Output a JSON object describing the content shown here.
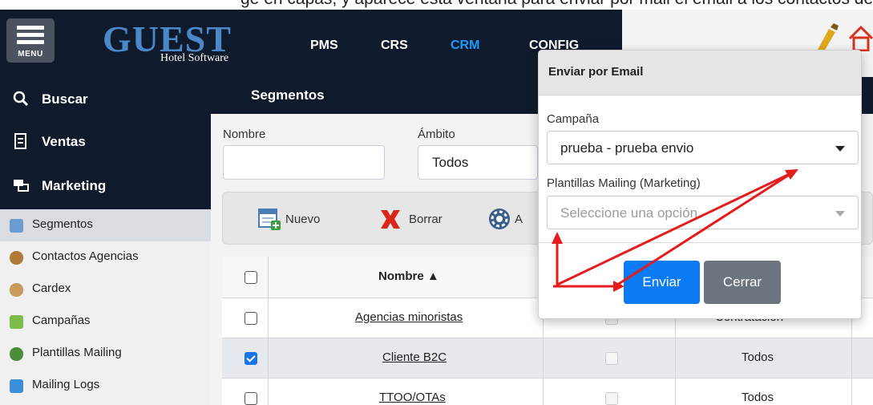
{
  "caption": "ge en capas, y aparece esta ventana para enviar por mail el email a los contactos del segmento que",
  "header": {
    "menu_label": "MENU",
    "logo": "GUEST",
    "logo_sub": "Hotel Software",
    "nav": [
      "PMS",
      "CRS",
      "CRM",
      "CONFIG"
    ],
    "active_nav": "CRM"
  },
  "sidebar": {
    "main": [
      {
        "label": "Buscar",
        "icon": "search-icon"
      },
      {
        "label": "Ventas",
        "icon": "sales-icon"
      },
      {
        "label": "Marketing",
        "icon": "marketing-icon"
      }
    ],
    "sub": [
      {
        "label": "Segmentos",
        "icon": "segments-icon",
        "active": true
      },
      {
        "label": "Contactos Agencias",
        "icon": "agency-contacts-icon"
      },
      {
        "label": "Cardex",
        "icon": "cardex-icon"
      },
      {
        "label": "Campañas",
        "icon": "campaigns-icon"
      },
      {
        "label": "Plantillas Mailing",
        "icon": "mailing-templates-icon"
      },
      {
        "label": "Mailing Logs",
        "icon": "mailing-logs-icon"
      }
    ]
  },
  "main": {
    "title": "Segmentos",
    "filters": {
      "nombre_label": "Nombre",
      "nombre_value": "",
      "ambito_label": "Ámbito",
      "ambito_value": "Todos"
    },
    "toolbar": {
      "nuevo": "Nuevo",
      "borrar": "Borrar",
      "third": "A"
    },
    "table": {
      "header": {
        "nombre": "Nombre ▲"
      },
      "rows": [
        {
          "nombre": "Agencias minoristas",
          "ambito": "Contratación",
          "checked": false
        },
        {
          "nombre": "Cliente B2C",
          "ambito": "Todos",
          "checked": true
        },
        {
          "nombre": "TTOO/OTAs",
          "ambito": "Todos",
          "checked": false
        }
      ]
    }
  },
  "modal": {
    "title": "Enviar por Email",
    "campaign_label": "Campaña",
    "campaign_value": "prueba - prueba envio",
    "templates_label": "Plantillas Mailing (Marketing)",
    "templates_placeholder": "Seleccione una opción",
    "send": "Enviar",
    "close": "Cerrar"
  },
  "colors": {
    "header_bg": "#0f1b2d",
    "accent": "#1a9cff",
    "primary_button": "#0a7bf2",
    "secondary_button": "#6c757d",
    "annotation_arrow": "#e51c1c"
  }
}
